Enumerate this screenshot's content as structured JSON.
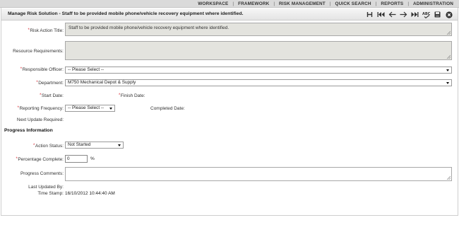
{
  "topnav": {
    "items": [
      "WORKSPACE",
      "FRAMEWORK",
      "RISK MANAGEMENT",
      "QUICK SEARCH",
      "REPORTS",
      "ADMINISTRATION"
    ]
  },
  "titlebar": {
    "title": "Manage Risk Solution - Staff to be provided mobile phone/vehicle recovery equipment where identified.",
    "icons": [
      "history-icon",
      "first-record-icon",
      "previous-record-icon",
      "next-record-icon",
      "last-record-icon",
      "spellcheck-icon",
      "save-icon",
      "close-icon"
    ]
  },
  "form": {
    "required_marker": "*",
    "risk_action_title": {
      "label": "Risk Action Title:",
      "value": "Staff to be provided mobile phone/vehicle recovery equipment where identified."
    },
    "resource_requirements": {
      "label": "Resource Requirements:",
      "value": ""
    },
    "responsible_officer": {
      "label": "Responsible Officer:",
      "value": "-- Please Select --"
    },
    "department": {
      "label": "Department:",
      "value": "M750 Mechanical Depot & Supply"
    },
    "start_date": {
      "label": "Start Date:",
      "value": ""
    },
    "finish_date": {
      "label": "Finish Date:",
      "value": ""
    },
    "reporting_frequency": {
      "label": "Reporting Frequency:",
      "value": "-- Please Select --"
    },
    "completed_date": {
      "label": "Completed Date:",
      "value": ""
    },
    "next_update_required": {
      "label": "Next Update Required:",
      "value": ""
    }
  },
  "progress": {
    "section_title": "Progress Information",
    "action_status": {
      "label": "Action Status:",
      "value": "Not Started"
    },
    "percentage_complete": {
      "label": "Percentage Complete:",
      "value": "0",
      "unit": "%"
    },
    "progress_comments": {
      "label": "Progress Comments:",
      "value": ""
    },
    "last_updated_by": {
      "label": "Last Updated By:",
      "value": ""
    },
    "time_stamp": {
      "label": "Time Stamp:",
      "value": "16/10/2012 10:44:40 AM"
    }
  },
  "colors": {
    "required": "#d4202a",
    "readonly_field": "#e3e3de",
    "nav_bar": "#dadada"
  }
}
